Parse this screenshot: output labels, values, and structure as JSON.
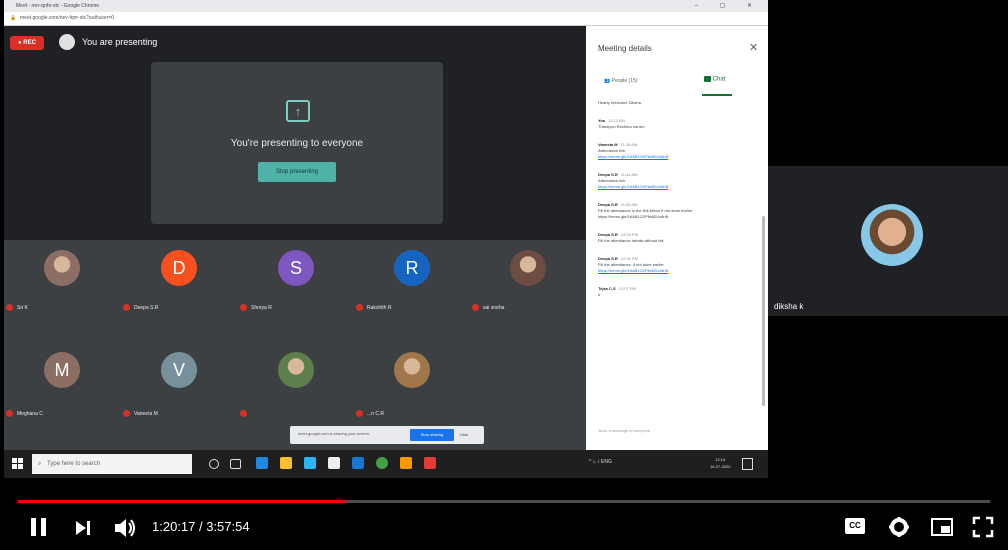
{
  "browser": {
    "window_title": "Meet - nev-qnhr-stc - Google Chrome",
    "window_controls": "–  ▢  ✕",
    "address": "meet.google.com/nev-fqnr-stc?authuser=0"
  },
  "meet": {
    "rec_label": "● REC",
    "presenting_label": "You are presenting",
    "share_card": {
      "icon": "present-to-all-icon",
      "message": "You're presenting to everyone",
      "stop_button": "Stop presenting"
    },
    "participants": [
      {
        "initial": "",
        "name": "Sri K",
        "color": "#8d6e63",
        "photo": true
      },
      {
        "initial": "D",
        "name": "Deepa S.R",
        "color": "#f4511e",
        "photo": false
      },
      {
        "initial": "S",
        "name": "Shreya R",
        "color": "#7e57c2",
        "photo": false
      },
      {
        "initial": "R",
        "name": "Rakshith R",
        "color": "#1565c0",
        "photo": false
      },
      {
        "initial": "",
        "name": "sai sneha",
        "color": "#6d4c41",
        "photo": true
      },
      {
        "initial": "M",
        "name": "Meghana C",
        "color": "#8d6e63",
        "photo": false
      },
      {
        "initial": "V",
        "name": "Vaneeta M",
        "color": "#78909c",
        "photo": false
      },
      {
        "initial": "",
        "name": "",
        "color": "#5d7f4e",
        "photo": true
      },
      {
        "initial": "",
        "name": "...n C.R",
        "color": "#a0764a",
        "photo": true
      }
    ],
    "share_bar": {
      "message": "meet.google.com is sharing your screen.",
      "stop_button": "Stop sharing",
      "hide_button": "Hide"
    }
  },
  "panel": {
    "title": "Meeting details",
    "close_icon": "✕",
    "tab_people": "People (15)",
    "tab_chat": "Chat",
    "messages": [
      {
        "sender": "",
        "time": "",
        "body": "Hearty Welcome Diksha",
        "link": ""
      },
      {
        "sender": "You",
        "time": "11:22 AM",
        "body": "Thankyou Reshma ma'am",
        "link": ""
      },
      {
        "sender": "Vaneeta M",
        "time": "11:26 AM",
        "body": "Attendance link",
        "link": "https://forms.gle/1A6B1CEPfw82Ux8nB"
      },
      {
        "sender": "Deepa S.R",
        "time": "11:44 AM",
        "body": "Attendance link",
        "link": "https://forms.gle/1A6B1CEPfw82Ux8nB"
      },
      {
        "sender": "Deepa S.R",
        "time": "11:50 AM",
        "body": "Fill the attendance in the link below if not done earlier https://forms.gle/1A6B1CEPfw82Ux8nB",
        "link": ""
      },
      {
        "sender": "Deepa S.R",
        "time": "12:04 PM",
        "body": "Fill the attendance details without fail",
        "link": ""
      },
      {
        "sender": "Deepa S.R",
        "time": "12:01 PM",
        "body": "Fill the attendance, if not done earlier",
        "link": "https://forms.gle/1A6B1CEPfw82Ux8nB"
      },
      {
        "sender": "Tejas C.S",
        "time": "12:07 PM",
        "body": "k",
        "link": ""
      }
    ],
    "input_placeholder": "Send a message to everyone"
  },
  "taskbar": {
    "search_placeholder": "Type here to search",
    "clock_time": "12:14",
    "clock_date": "16-07-2020",
    "tray_text": "^ ⌂ ♪ ENG"
  },
  "right_tile": {
    "name": "diksha k"
  },
  "player": {
    "time_display": "1:20:17 / 3:57:54",
    "progress_fraction": 0.3369,
    "buttons": [
      "pause-icon",
      "next-icon",
      "volume-icon",
      "cc-icon",
      "settings-icon",
      "miniplayer-icon",
      "fullscreen-icon"
    ],
    "cc_label": "CC"
  }
}
